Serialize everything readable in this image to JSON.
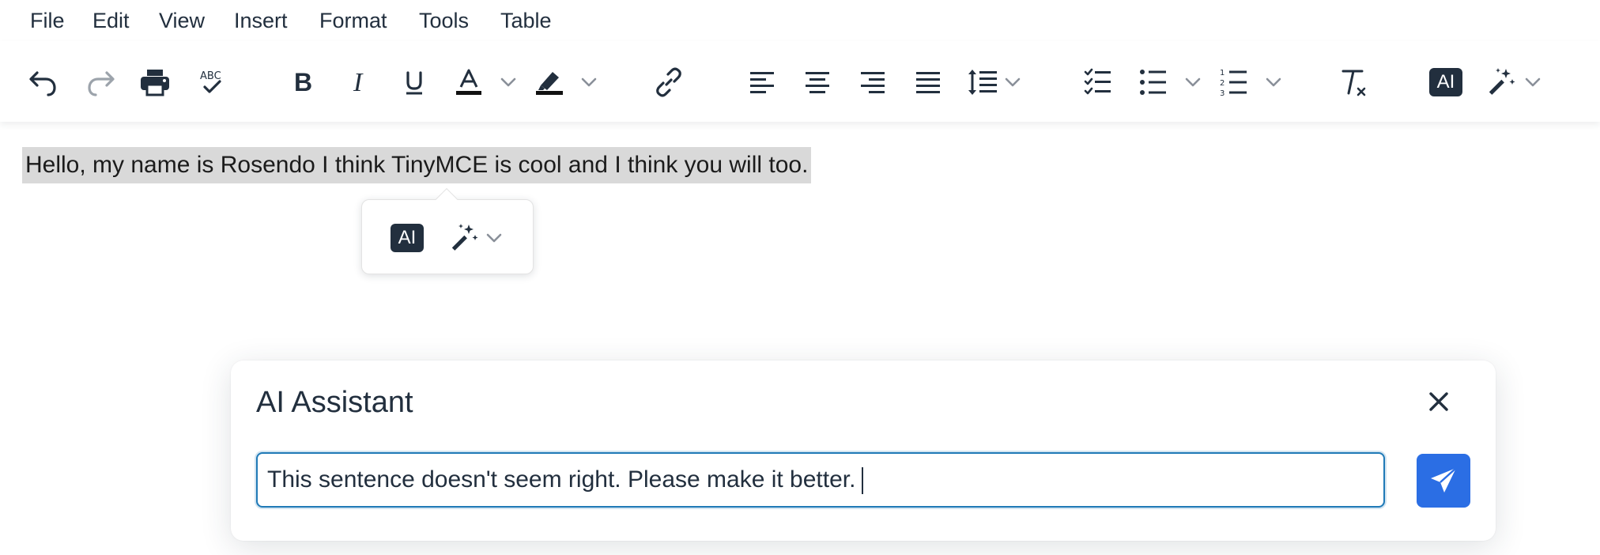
{
  "menubar": {
    "items": [
      "File",
      "Edit",
      "View",
      "Insert",
      "Format",
      "Tools",
      "Table"
    ]
  },
  "toolbar": {
    "ai_label": "AI"
  },
  "editor": {
    "content": "Hello, my name is Rosendo I think TinyMCE is cool and I think you will too."
  },
  "quickbar": {
    "ai_label": "AI"
  },
  "ai_dialog": {
    "title": "AI Assistant",
    "prompt_value": "This sentence doesn't seem right. Please make it better."
  },
  "colors": {
    "icon": "#222f3e",
    "disabled_icon": "#9ca3ab",
    "chevron": "#8a9099",
    "accent": "#207ab7",
    "send_button": "#2b6ee4",
    "selection": "#d9d9d9"
  },
  "icons": [
    "undo-icon",
    "redo-icon",
    "print-icon",
    "spellcheck-icon",
    "bold-icon",
    "italic-icon",
    "underline-icon",
    "text-color-icon",
    "highlight-icon",
    "link-icon",
    "align-left-icon",
    "align-center-icon",
    "align-right-icon",
    "align-justify-icon",
    "line-height-icon",
    "checklist-icon",
    "bullet-list-icon",
    "numbered-list-icon",
    "clear-formatting-icon",
    "ai-icon",
    "magic-wand-icon",
    "close-icon",
    "send-icon"
  ]
}
